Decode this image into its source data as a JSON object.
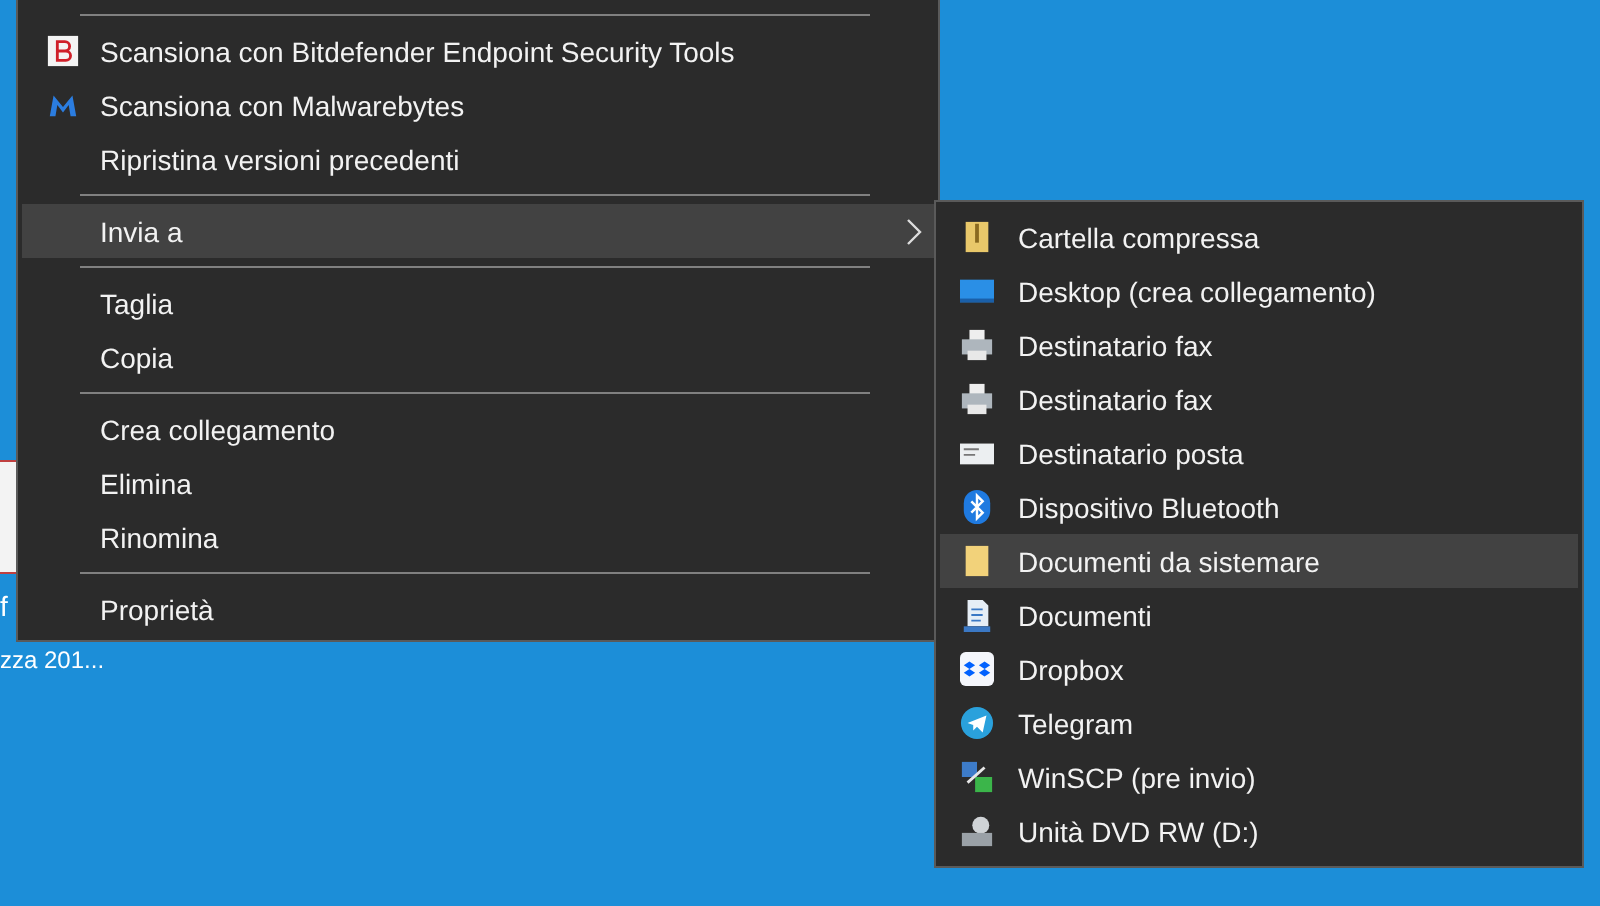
{
  "desktop": {
    "icon_label_lines": [
      "f",
      "zza 201..."
    ]
  },
  "context_menu": {
    "items": [
      {
        "kind": "separator"
      },
      {
        "kind": "bitdefender",
        "label": "Scansiona con Bitdefender Endpoint Security Tools",
        "selected": false,
        "has_submenu": false
      },
      {
        "kind": "malwarebytes",
        "label": "Scansiona con Malwarebytes",
        "selected": false,
        "has_submenu": false
      },
      {
        "kind": "item",
        "label": "Ripristina versioni precedenti",
        "selected": false,
        "has_submenu": false
      },
      {
        "kind": "separator"
      },
      {
        "kind": "item",
        "label": "Invia a",
        "selected": true,
        "has_submenu": true
      },
      {
        "kind": "separator"
      },
      {
        "kind": "item",
        "label": "Taglia",
        "selected": false,
        "has_submenu": false
      },
      {
        "kind": "item",
        "label": "Copia",
        "selected": false,
        "has_submenu": false
      },
      {
        "kind": "separator"
      },
      {
        "kind": "item",
        "label": "Crea collegamento",
        "selected": false,
        "has_submenu": false
      },
      {
        "kind": "item",
        "label": "Elimina",
        "selected": false,
        "has_submenu": false
      },
      {
        "kind": "item",
        "label": "Rinomina",
        "selected": false,
        "has_submenu": false
      },
      {
        "kind": "separator"
      },
      {
        "kind": "item",
        "label": "Proprietà",
        "selected": false,
        "has_submenu": false
      }
    ]
  },
  "submenu": {
    "items": [
      {
        "label": "Cartella compressa",
        "kind": "zip",
        "selected": false
      },
      {
        "label": "Desktop (crea collegamento)",
        "kind": "desktop",
        "selected": false
      },
      {
        "label": "Destinatario fax",
        "kind": "fax",
        "selected": false
      },
      {
        "label": "Destinatario fax",
        "kind": "fax",
        "selected": false
      },
      {
        "label": "Destinatario posta",
        "kind": "mail",
        "selected": false
      },
      {
        "label": "Dispositivo Bluetooth",
        "kind": "bluetooth",
        "selected": false
      },
      {
        "label": "Documenti da sistemare",
        "kind": "folder",
        "selected": true
      },
      {
        "label": "Documenti",
        "kind": "documents",
        "selected": false
      },
      {
        "label": "Dropbox",
        "kind": "dropbox",
        "selected": false
      },
      {
        "label": "Telegram",
        "kind": "telegram",
        "selected": false
      },
      {
        "label": "WinSCP (pre invio)",
        "kind": "winscp",
        "selected": false
      },
      {
        "label": "Unità DVD RW (D:)",
        "kind": "dvd",
        "selected": false
      }
    ]
  }
}
